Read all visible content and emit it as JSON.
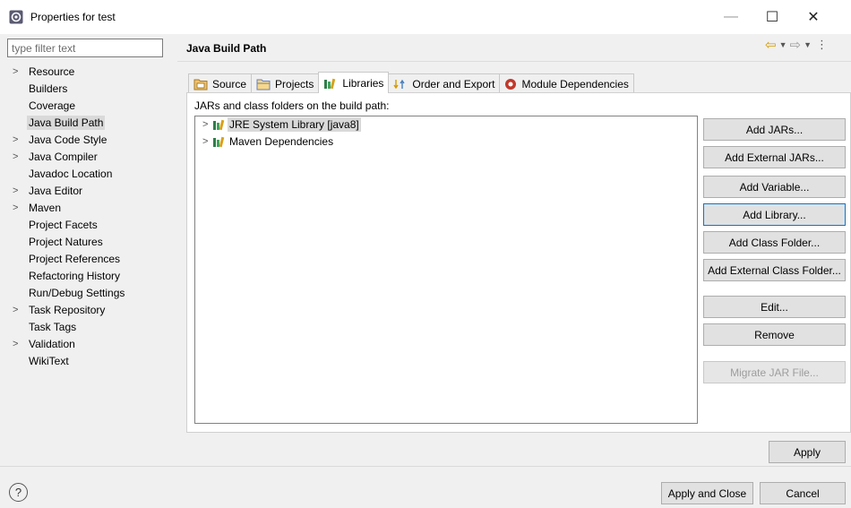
{
  "window": {
    "title": "Properties for test",
    "icon": "eclipse-properties-icon",
    "minimize_glyph": "—",
    "maximize_glyph": "☐",
    "close_glyph": "✕"
  },
  "filter": {
    "placeholder": "type filter text",
    "value": ""
  },
  "nav": {
    "items": [
      {
        "label": "Resource",
        "expandable": true
      },
      {
        "label": "Builders",
        "expandable": false
      },
      {
        "label": "Coverage",
        "expandable": false
      },
      {
        "label": "Java Build Path",
        "expandable": false,
        "selected": true
      },
      {
        "label": "Java Code Style",
        "expandable": true
      },
      {
        "label": "Java Compiler",
        "expandable": true
      },
      {
        "label": "Javadoc Location",
        "expandable": false
      },
      {
        "label": "Java Editor",
        "expandable": true
      },
      {
        "label": "Maven",
        "expandable": true
      },
      {
        "label": "Project Facets",
        "expandable": false
      },
      {
        "label": "Project Natures",
        "expandable": false
      },
      {
        "label": "Project References",
        "expandable": false
      },
      {
        "label": "Refactoring History",
        "expandable": false
      },
      {
        "label": "Run/Debug Settings",
        "expandable": false
      },
      {
        "label": "Task Repository",
        "expandable": true
      },
      {
        "label": "Task Tags",
        "expandable": false
      },
      {
        "label": "Validation",
        "expandable": true
      },
      {
        "label": "WikiText",
        "expandable": false
      }
    ]
  },
  "panel": {
    "title": "Java Build Path",
    "tabs": [
      {
        "label": "Source",
        "icon": "source-folder-icon"
      },
      {
        "label": "Projects",
        "icon": "projects-folder-icon"
      },
      {
        "label": "Libraries",
        "icon": "libraries-icon",
        "active": true
      },
      {
        "label": "Order and Export",
        "icon": "order-export-icon"
      },
      {
        "label": "Module Dependencies",
        "icon": "module-dependencies-icon"
      }
    ],
    "section_label": "JARs and class folders on the build path:",
    "libraries": [
      {
        "label": "JRE System Library [java8]",
        "selected": true
      },
      {
        "label": "Maven Dependencies",
        "selected": false
      }
    ]
  },
  "buttons": {
    "add_jars": "Add JARs...",
    "add_external_jars": "Add External JARs...",
    "add_variable": "Add Variable...",
    "add_library": "Add Library...",
    "add_class_folder": "Add Class Folder...",
    "add_external_class_folder": "Add External Class Folder...",
    "edit": "Edit...",
    "remove": "Remove",
    "migrate_jar": "Migrate JAR File...",
    "apply": "Apply",
    "apply_and_close": "Apply and Close",
    "cancel": "Cancel"
  },
  "help": {
    "glyph": "?"
  },
  "colors": {
    "accent_focus": "#0078d7",
    "selection": "#d9d9d9",
    "library_icon": "#1e9c5a"
  }
}
